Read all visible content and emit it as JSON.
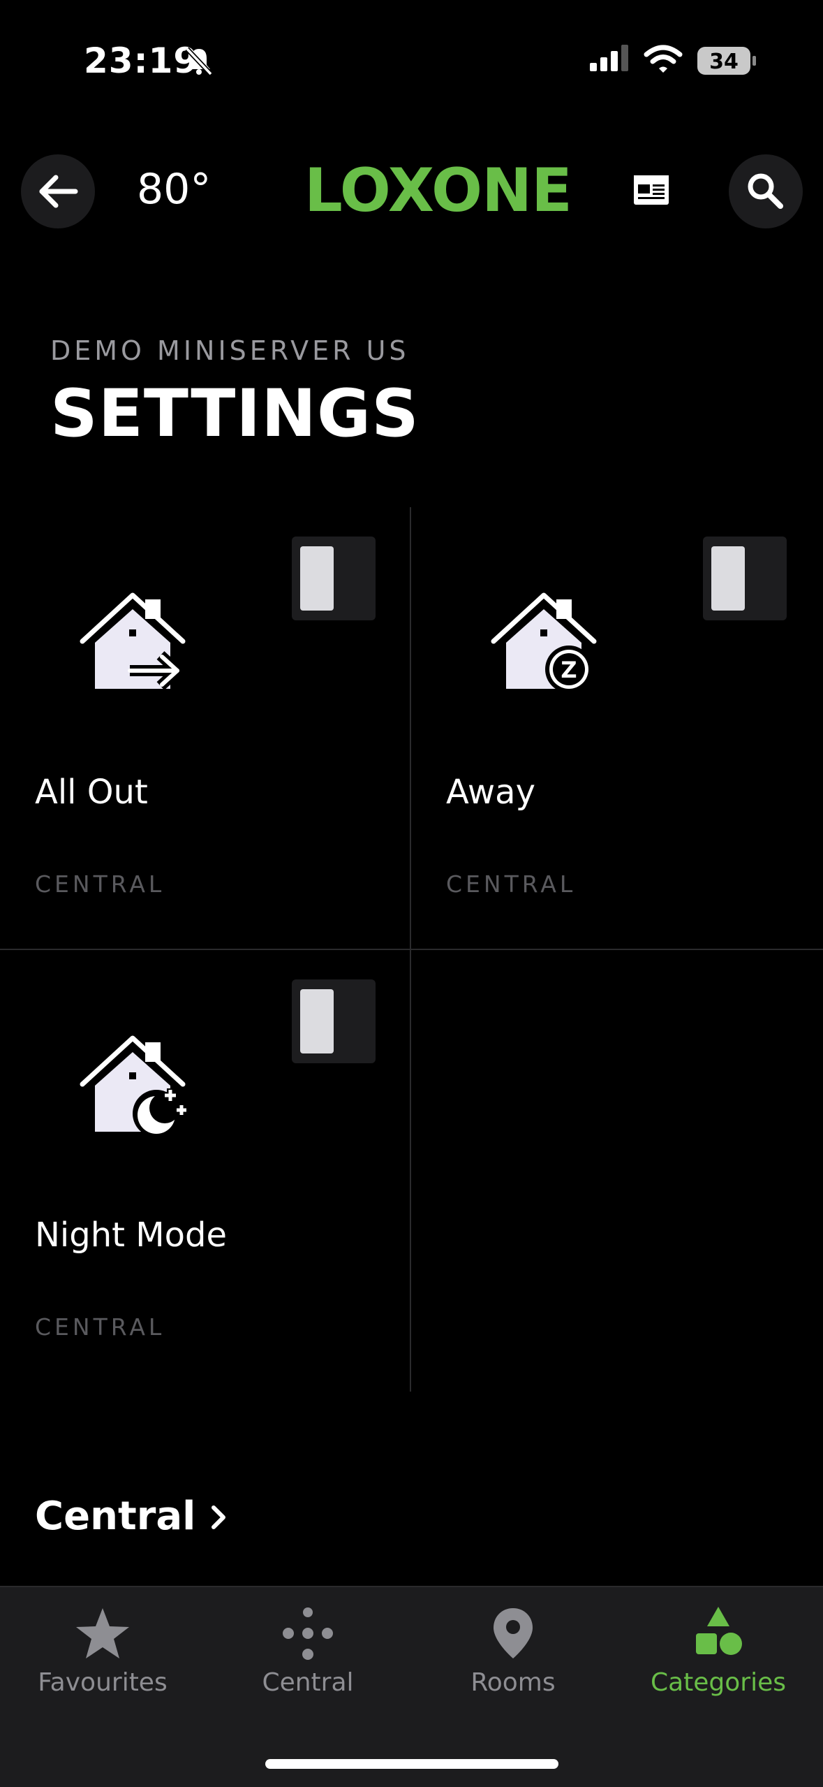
{
  "status_bar": {
    "time": "23:19",
    "battery": "34"
  },
  "header": {
    "temperature": "80°",
    "logo": "LOXONE"
  },
  "page": {
    "subtitle": "DEMO MINISERVER US",
    "title": "SETTINGS"
  },
  "tiles": [
    {
      "name": "All Out",
      "category": "CENTRAL",
      "icon": "house-exit-icon",
      "active": false
    },
    {
      "name": "Away",
      "category": "CENTRAL",
      "icon": "house-sleep-icon",
      "active": false
    },
    {
      "name": "Night Mode",
      "category": "CENTRAL",
      "icon": "house-moon-icon",
      "active": false
    }
  ],
  "section_link": {
    "label": "Central"
  },
  "tab_bar": {
    "items": [
      {
        "label": "Favourites",
        "icon": "star-icon"
      },
      {
        "label": "Central",
        "icon": "dots-icon"
      },
      {
        "label": "Rooms",
        "icon": "location-pin-icon"
      },
      {
        "label": "Categories",
        "icon": "shapes-icon",
        "active": true
      }
    ]
  },
  "colors": {
    "accent": "#69be48",
    "background": "#000000",
    "tab_bar": "#1c1c1e"
  }
}
